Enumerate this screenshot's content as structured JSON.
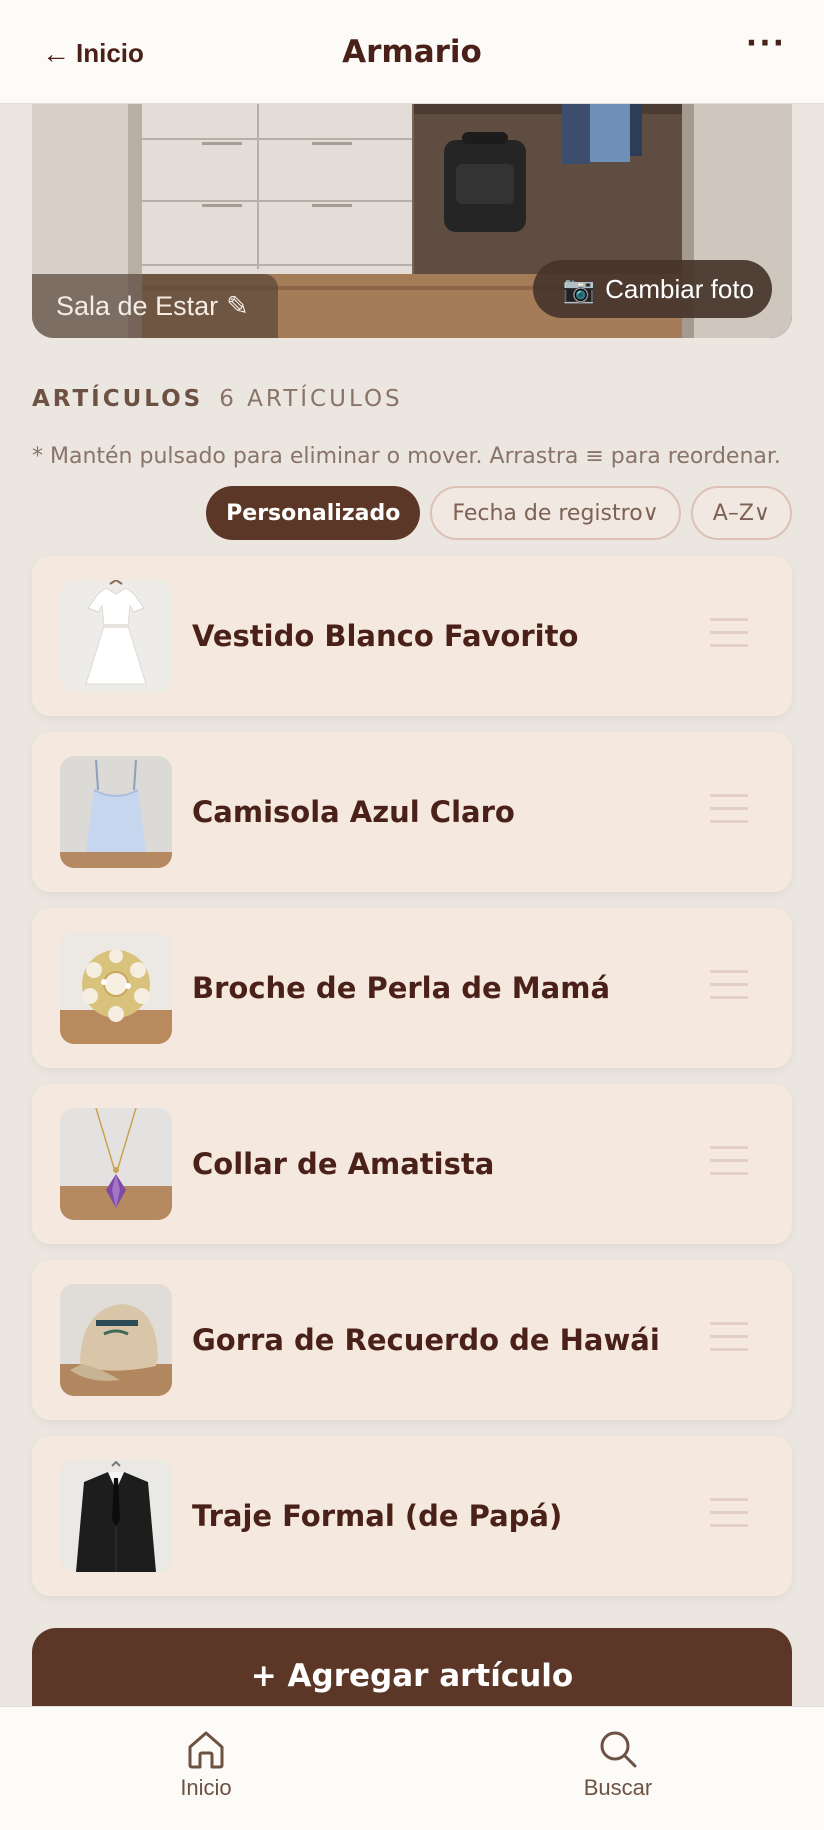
{
  "header": {
    "back_arrow": "←",
    "back_label": "Inicio",
    "title": "Armario",
    "more": "···"
  },
  "hero": {
    "room_label": "Sala de Estar",
    "edit_icon": "✎",
    "camera_icon": "📷",
    "change_photo_label": "Cambiar foto"
  },
  "section": {
    "title": "ARTÍCULOS",
    "count": "6 ARTÍCULOS",
    "hint": "* Mantén pulsado para eliminar o mover. Arrastra ≡ para reordenar."
  },
  "sort": {
    "custom": "Personalizado",
    "date": "Fecha de registro∨",
    "az": "A–Z∨"
  },
  "items": [
    {
      "name": "Vestido Blanco Favorito",
      "thumb": "white-dress"
    },
    {
      "name": "Camisola Azul Claro",
      "thumb": "blue-camisole"
    },
    {
      "name": "Broche de Perla de Mamá",
      "thumb": "pearl-brooch"
    },
    {
      "name": "Collar de Amatista",
      "thumb": "amethyst-necklace"
    },
    {
      "name": "Gorra de Recuerdo de Hawái",
      "thumb": "hawaii-cap"
    },
    {
      "name": "Traje Formal (de Papá)",
      "thumb": "black-suit"
    }
  ],
  "add_button": {
    "label": "+ Agregar artículo"
  },
  "nav": {
    "home": "Inicio",
    "search": "Buscar"
  },
  "colors": {
    "accent": "#5c3627",
    "background": "#ebe6e0",
    "card": "#f5e8df",
    "text": "#4a2118"
  }
}
